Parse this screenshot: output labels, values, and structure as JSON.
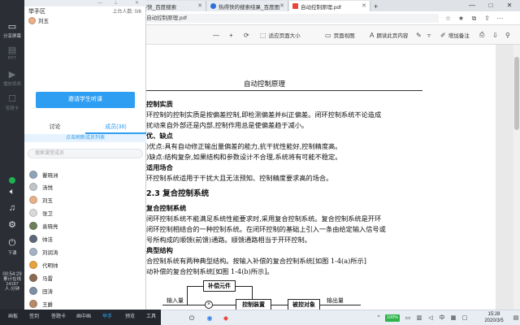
{
  "browser": {
    "tabs": [
      {
        "label": "热得快_百度搜索",
        "color": "#2f6fe0"
      },
      {
        "label": "热得快的搜索结果_百度图",
        "color": "#2f6fe0"
      },
      {
        "label": "自动控制原理.pdf",
        "color": "#e8463b"
      }
    ],
    "window_controls": [
      "—",
      "□",
      "✕"
    ],
    "address": "ktop/自动控制原理.pdf"
  },
  "pdf_toolbar": {
    "minus": "—",
    "plus": "+",
    "fit_page": "适应页面大小",
    "page_view": "页面视图",
    "read_aloud": "朗读此页内容",
    "add_note": "增加备注"
  },
  "doc": {
    "header": "自动控制原理",
    "lines": [
      "控制实质",
      "环控制的控制实质是按偏差控制,即检测偏差并纠正偏差。闭环控制系统不论造成",
      "扰动来自外部还是内部,控制作用总是使偏差趋于减小。",
      "优、缺点",
      ")优点:具有自动修正输出量偏差的能力,抗干扰性能好,控制精度高。",
      ")缺点:结构复杂,如果结构和参数设计不合理,系统将有可能不稳定。",
      "适用场合",
      "环控制系统适用于干扰大且无法预知、控制精度要求高的场合。"
    ],
    "section": "2.3   复合控制系统",
    "lines2": [
      "复合控制系统",
      "闭环控制系统不能满足系统性能要求时,采用复合控制系统。复合控制系统是开环",
      "闭环控制相结合的一种控制系统。在闭环控制的基础上引入一条由给定输入信号或",
      "号所构成的顺馈(前馈)通路。顺馈通路相当于开环控制。",
      "典型结构",
      "合控制系统有两种典型结构。按输入补偿的复合控制系统[如图 1-4(a)所示]",
      "动补偿的复合控制系统[如图 1-4(b)所示]。"
    ],
    "diagram": {
      "comp": "补偿元件",
      "controller": "控制装置",
      "plant": "被控对象",
      "input": "输入量",
      "output": "输出量"
    }
  },
  "left_toolbar": {
    "share": "分享屏幕",
    "ppt": "PPT",
    "item3": "播放视频",
    "item4": "答题卡",
    "exit": "下课"
  },
  "panel": {
    "stage_title": "举手区",
    "stage_count": "上台人数: 0/6",
    "stage_user": "刘玉",
    "invite": "邀请学生听课",
    "tab_discuss": "讨论",
    "tab_members": "成员(38)",
    "notice": "点击刷新成员列表",
    "search_placeholder": "搜索课堂成员",
    "members": [
      "瞿晓洲",
      "汤悦",
      "刘玉",
      "张卫",
      "袁晓亮",
      "帅洁",
      "刘润涛",
      "代明帅",
      "马雷",
      "田涛",
      "王爵"
    ]
  },
  "timer": {
    "time": "00:54:29",
    "label1": "累计在线",
    "count": "14197",
    "label2": "人·分钟"
  },
  "bottom_bar": [
    "画板",
    "签到",
    "答题卡",
    "画中画",
    "举手",
    "预览",
    "工具"
  ],
  "bottom_active": "举手",
  "taskbar": {
    "battery": "100%",
    "lang": "中",
    "time": "15:28",
    "date": "2020/3/5"
  }
}
